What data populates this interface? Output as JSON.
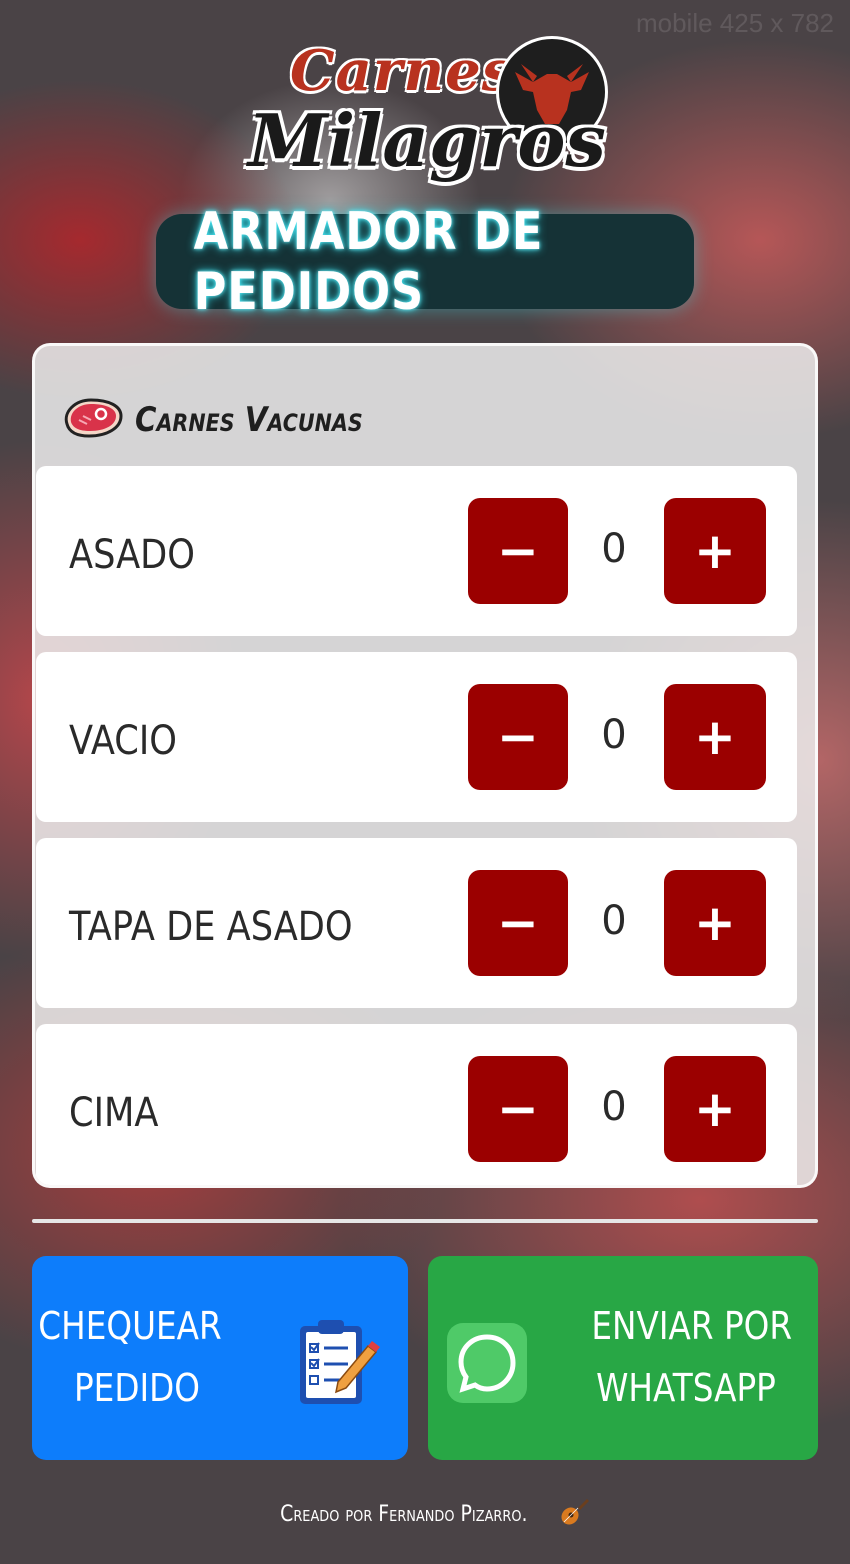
{
  "watermark": "mobile 425 x 782",
  "logo": {
    "top_word": "Carnes",
    "bottom_word": "Milagros",
    "badge_icon": "bull-head-icon"
  },
  "title": "ARMADOR DE PEDIDOS",
  "section": {
    "title": "Carnes Vacunas",
    "icon": "steak-icon"
  },
  "items": [
    {
      "name": "ASADO",
      "qty": "0"
    },
    {
      "name": "VACIO",
      "qty": "0"
    },
    {
      "name": "TAPA DE ASADO",
      "qty": "0"
    },
    {
      "name": "CIMA",
      "qty": "0"
    }
  ],
  "controls": {
    "minus": "−",
    "plus": "+"
  },
  "actions": {
    "check": {
      "line1": "CHEQUEAR",
      "line2": "PEDIDO",
      "icon": "clipboard-checklist-icon"
    },
    "whatsapp": {
      "line1": "ENVIAR POR",
      "line2": "WHATSAPP",
      "icon": "whatsapp-icon"
    }
  },
  "footer": {
    "text": "Creado por Fernando Pizarro.",
    "icon": "guitar-icon"
  },
  "colors": {
    "accent_red": "#9b0000",
    "check_blue": "#0d7dfb",
    "whatsapp_green": "#28a745",
    "title_glow": "#33e0ee"
  }
}
